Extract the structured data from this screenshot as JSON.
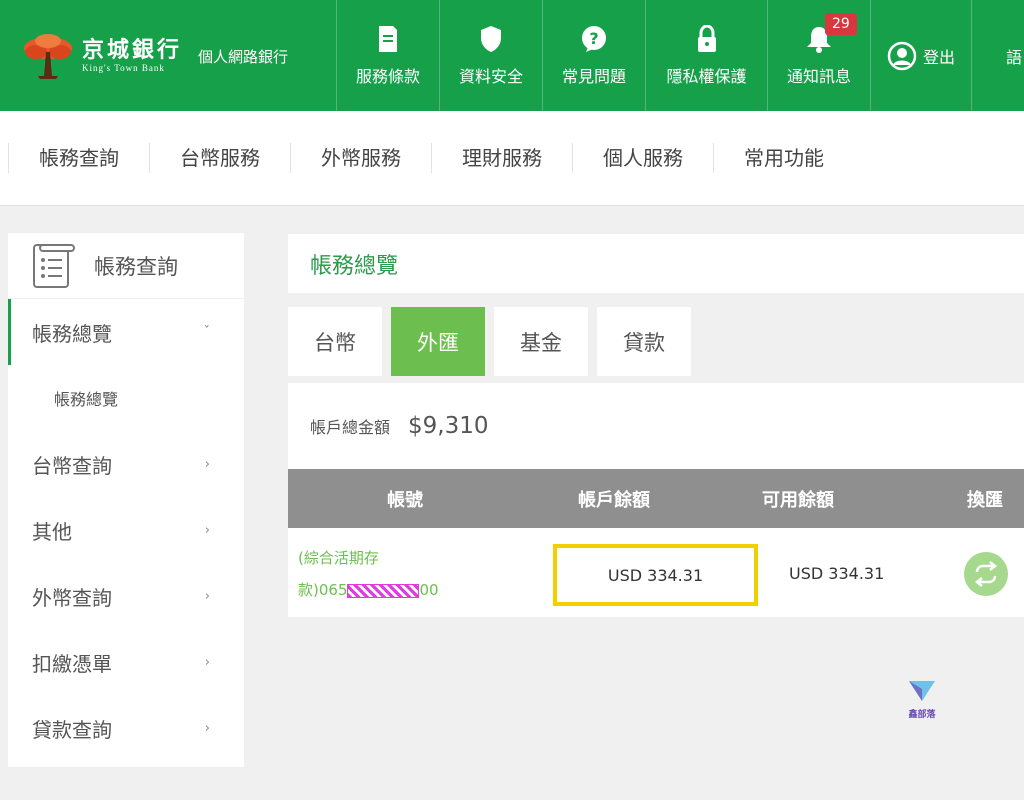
{
  "header": {
    "brand_name": "京城銀行",
    "brand_en": "King's Town Bank",
    "brand_sub": "個人網路銀行",
    "nav": [
      {
        "label": "服務條款",
        "icon": "document-icon"
      },
      {
        "label": "資料安全",
        "icon": "shield-icon"
      },
      {
        "label": "常見問題",
        "icon": "question-bubble-icon"
      },
      {
        "label": "隱私權保護",
        "icon": "lock-icon"
      },
      {
        "label": "通知訊息",
        "icon": "bell-icon",
        "badge": "29"
      }
    ],
    "login_label": "登出",
    "language_label": "語"
  },
  "menu": [
    "帳務查詢",
    "台幣服務",
    "外幣服務",
    "理財服務",
    "個人服務",
    "常用功能"
  ],
  "sidebar": {
    "title": "帳務查詢",
    "active_item": "帳務總覽",
    "active_chevron": "ˇ",
    "sub_item": "帳務總覽",
    "items": [
      "台幣查詢",
      "其他",
      "外幣查詢",
      "扣繳憑單",
      "貸款查詢"
    ],
    "chevron": "›"
  },
  "main": {
    "title": "帳務總覽",
    "tabs": [
      "台幣",
      "外匯",
      "基金",
      "貸款"
    ],
    "active_tab": "外匯",
    "total_label": "帳戶總金額",
    "total_value": "$9,310",
    "table": {
      "headers": [
        "帳號",
        "帳戶餘額",
        "可用餘額",
        "換匯"
      ],
      "rows": [
        {
          "account_line1": "(綜合活期存",
          "account_prefix": "款)065",
          "account_suffix": "00",
          "balance": "USD 334.31",
          "available": "USD 334.31"
        }
      ]
    }
  },
  "watermark": "鑫部落",
  "colors": {
    "brand_green": "#16a04a",
    "tab_active": "#6cbf4e",
    "table_header": "#8f8f8f",
    "highlight": "#f2d000",
    "badge": "#d9363e"
  }
}
